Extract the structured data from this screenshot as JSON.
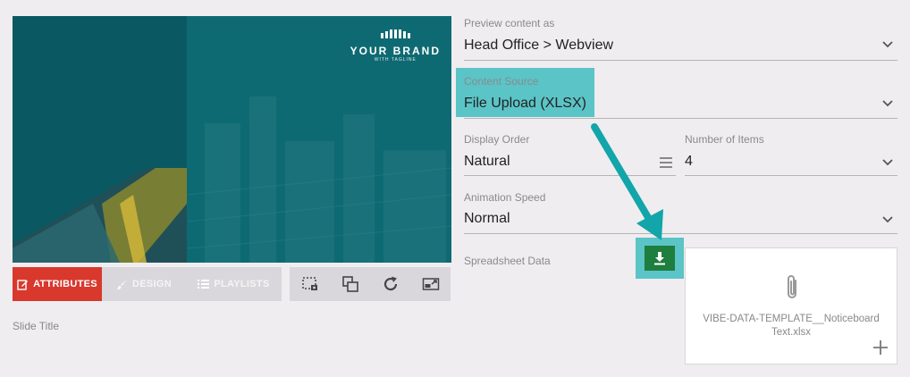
{
  "preview": {
    "brand_name": "YOUR BRAND",
    "brand_tagline": "WITH TAGLINE"
  },
  "tabs": [
    {
      "label": "ATTRIBUTES",
      "icon": "edit-icon",
      "active": true
    },
    {
      "label": "DESIGN",
      "icon": "brush-icon",
      "active": false
    },
    {
      "label": "PLAYLISTS",
      "icon": "list-icon",
      "active": false
    }
  ],
  "toolbar": {
    "icons": [
      "crop-screenshot-icon",
      "layers-icon",
      "refresh-icon",
      "resize-icon"
    ]
  },
  "slide_title": {
    "label": "Slide Title"
  },
  "preview_content": {
    "label": "Preview content as",
    "value": "Head Office > Webview"
  },
  "content_source": {
    "label": "Content Source",
    "value": "File Upload (XLSX)"
  },
  "display_order": {
    "label": "Display Order",
    "value": "Natural"
  },
  "number_of_items": {
    "label": "Number of Items",
    "value": "4"
  },
  "animation_speed": {
    "label": "Animation Speed",
    "value": "Normal"
  },
  "spreadsheet": {
    "label": "Spreadsheet Data",
    "file_name": "VIBE-DATA-TEMPLATE__NoticeboardText.xlsx"
  },
  "colors": {
    "accent_red": "#d9382d",
    "highlight_teal": "#5bc4c7",
    "download_green": "#1e7e3d",
    "arrow_teal": "#12a5a9"
  }
}
